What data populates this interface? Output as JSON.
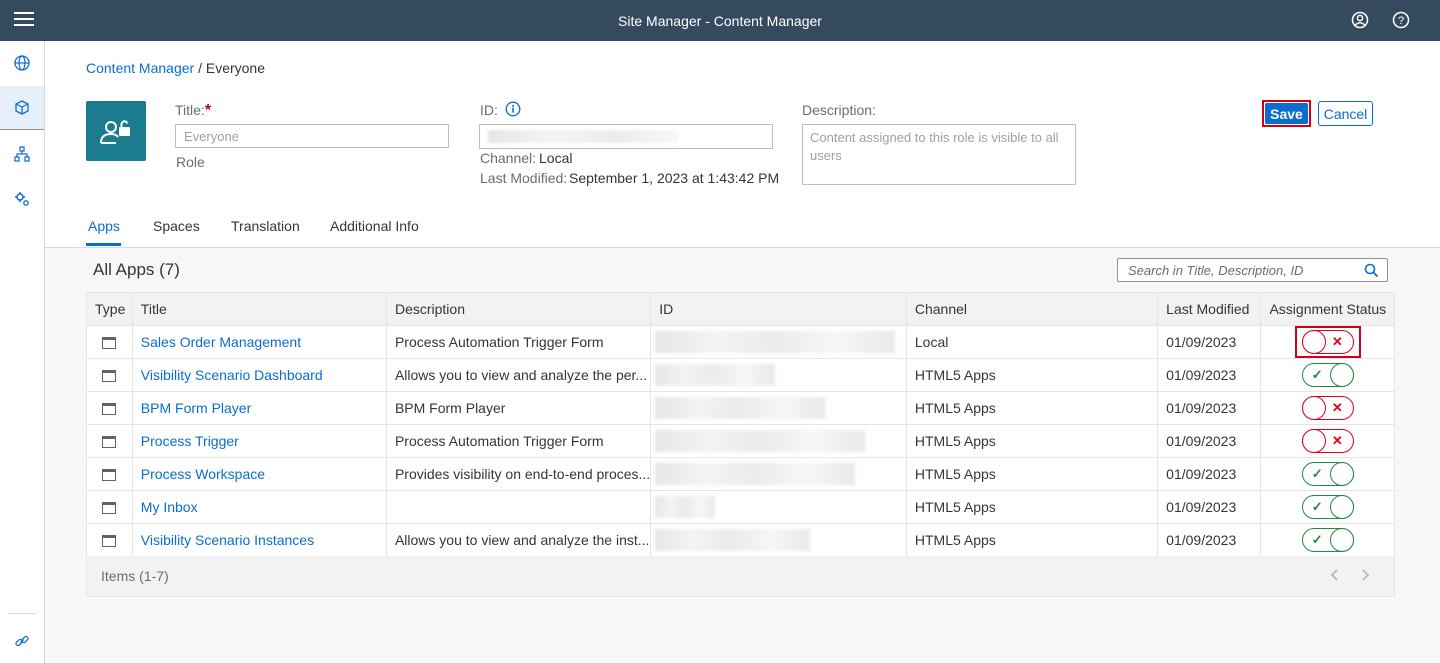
{
  "shell": {
    "title": "Site Manager - Content Manager"
  },
  "breadcrumb": {
    "link": "Content Manager",
    "separator": "/",
    "current": "Everyone"
  },
  "role": {
    "title_label": "Title:",
    "title_required": "*",
    "title_placeholder": "Everyone",
    "subtitle": "Role",
    "id_label": "ID:",
    "channel_label": "Channel:",
    "channel_value": "Local",
    "modified_label": "Last Modified:",
    "modified_value": "September 1, 2023 at 1:43:42 PM",
    "description_label": "Description:",
    "description_placeholder": "Content assigned to this role is visible to all users"
  },
  "actions": {
    "save": "Save",
    "cancel": "Cancel"
  },
  "tabs": [
    "Apps",
    "Spaces",
    "Translation",
    "Additional Info"
  ],
  "active_tab": "Apps",
  "table": {
    "title": "All Apps (7)",
    "search_placeholder": "Search in Title, Description, ID",
    "columns": [
      "Type",
      "Title",
      "Description",
      "ID",
      "Channel",
      "Last Modified",
      "Assignment Status"
    ],
    "rows": [
      {
        "title": "Sales Order Management",
        "description": "Process Automation Trigger Form",
        "channel": "Local",
        "modified": "01/09/2023",
        "assigned": false
      },
      {
        "title": "Visibility Scenario Dashboard",
        "description": "Allows you to view and analyze the per...",
        "channel": "HTML5 Apps",
        "modified": "01/09/2023",
        "assigned": true
      },
      {
        "title": "BPM Form Player",
        "description": "BPM Form Player",
        "channel": "HTML5 Apps",
        "modified": "01/09/2023",
        "assigned": false
      },
      {
        "title": "Process Trigger",
        "description": "Process Automation Trigger Form",
        "channel": "HTML5 Apps",
        "modified": "01/09/2023",
        "assigned": false
      },
      {
        "title": "Process Workspace",
        "description": "Provides visibility on end-to-end proces...",
        "channel": "HTML5 Apps",
        "modified": "01/09/2023",
        "assigned": true
      },
      {
        "title": "My Inbox",
        "description": "",
        "channel": "HTML5 Apps",
        "modified": "01/09/2023",
        "assigned": true
      },
      {
        "title": "Visibility Scenario Instances",
        "description": "Allows you to view and analyze the inst...",
        "channel": "HTML5 Apps",
        "modified": "01/09/2023",
        "assigned": true
      }
    ],
    "footer": "Items (1-7)"
  },
  "colors": {
    "shell": "#354a5f",
    "accent": "#0a6ed1",
    "role_tile": "#1b7c8f",
    "off": "#e0001f",
    "on": "#1e8a3d"
  }
}
